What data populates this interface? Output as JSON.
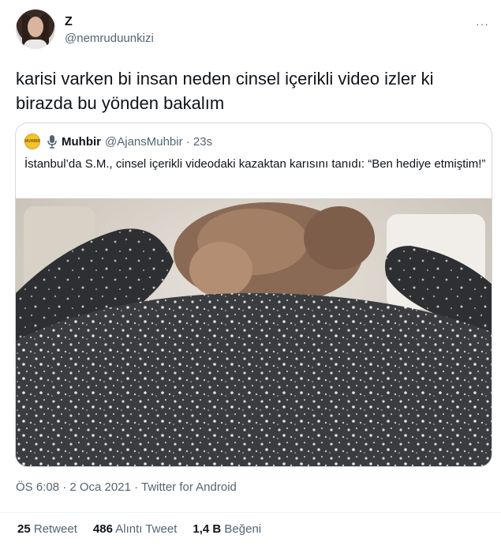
{
  "author": {
    "name": "Z",
    "handle": "@nemruduunkizi"
  },
  "more_icon": "···",
  "tweet_text": "karisi varken bi insan neden cinsel içerikli video izler ki birazda bu yönden bakalım",
  "quoted": {
    "logo_text": "MUHBIR",
    "name": "Muhbir",
    "handle": "@AjansMuhbir · 23s",
    "text": "İstanbul’da S.M., cinsel içerikli videodaki kazaktan karısını tanıdı: “Ben hediye etmiştim!”",
    "media": "video-still-person-in-sparkly-sweater"
  },
  "meta": "ÖS 6:08 · 2 Oca 2021 · Twitter for Android",
  "stats": {
    "retweets": {
      "count": "25",
      "label": "Retweet"
    },
    "quotes": {
      "count": "486",
      "label": "Alıntı Tweet"
    },
    "likes": {
      "count": "1,4 B",
      "label": "Beğeni"
    }
  },
  "colors": {
    "text": "#0f1419",
    "secondary": "#536471",
    "border": "#cfd9de",
    "logo": "#f2c230"
  }
}
